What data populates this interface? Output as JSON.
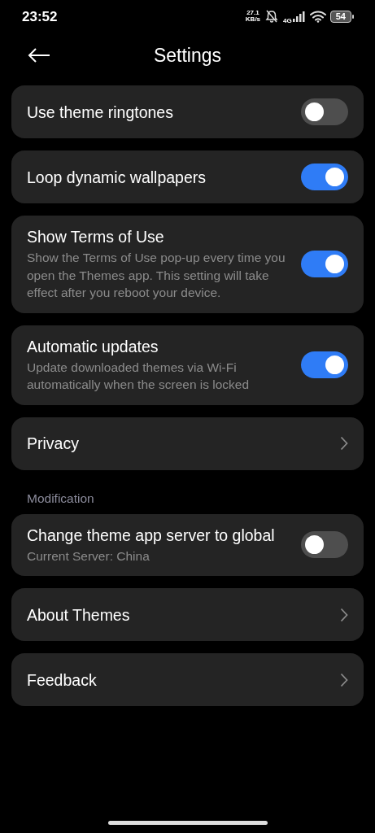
{
  "status_bar": {
    "time": "23:52",
    "speed_value": "27.1",
    "speed_unit": "KB/s",
    "network": "4G",
    "battery": "54"
  },
  "header": {
    "title": "Settings"
  },
  "items": [
    {
      "kind": "switch",
      "title": "Use theme ringtones",
      "on": false
    },
    {
      "kind": "switch",
      "title": "Loop dynamic wallpapers",
      "on": true
    },
    {
      "kind": "switch",
      "title": "Show Terms of Use",
      "subtitle": "Show the Terms of Use pop-up every time you open the Themes app. This setting will take effect after you reboot your device.",
      "on": true
    },
    {
      "kind": "switch",
      "title": "Automatic updates",
      "subtitle": "Update downloaded themes via Wi-Fi automatically when the screen is locked",
      "on": true
    },
    {
      "kind": "link",
      "title": "Privacy"
    },
    {
      "kind": "section",
      "title": "Modification"
    },
    {
      "kind": "switch",
      "title": "Change theme app server to global",
      "subtitle": "Current Server: China",
      "on": false
    },
    {
      "kind": "link",
      "title": "About Themes"
    },
    {
      "kind": "link",
      "title": "Feedback"
    }
  ]
}
